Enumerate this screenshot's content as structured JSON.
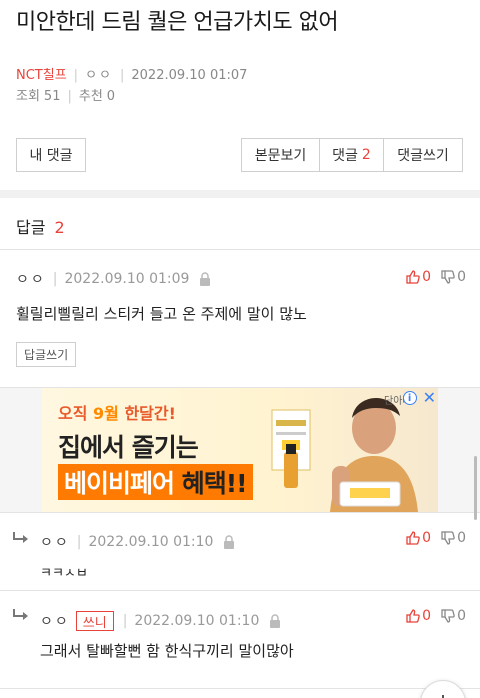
{
  "post": {
    "title": "미안한데 드림 퀄은 언급가치도 없어",
    "board": "NCT칠프",
    "author": "ㅇㅇ",
    "datetime": "2022.09.10 01:07",
    "views_label": "조회",
    "views": "51",
    "recommend_label": "추천",
    "recommend": "0"
  },
  "actions": {
    "my_comments": "내 댓글",
    "view_post": "본문보기",
    "comments_label": "댓글",
    "comments_count": "2",
    "write_comment": "댓글쓰기"
  },
  "replies_header": {
    "label": "답글",
    "count": "2"
  },
  "comments": [
    {
      "author": "ㅇㅇ",
      "datetime": "2022.09.10 01:09",
      "text": "휠릴리삘릴리 스티커 들고 온 주제에 말이 많노",
      "up": "0",
      "down": "0",
      "reply_button": "답글쓰기"
    },
    {
      "author": "ㅇㅇ",
      "datetime": "2022.09.10 01:10",
      "text": "ㅋㅋㅅㅂ",
      "up": "0",
      "down": "0"
    },
    {
      "author": "ㅇㅇ",
      "badge": "쓰니",
      "datetime": "2022.09.10 01:10",
      "text": "그래서 탈빠할뻔 함 한식구끼리 말이많아",
      "up": "0",
      "down": "0"
    }
  ],
  "ad": {
    "line1_a": "오직 ",
    "line1_hi": "9월",
    "line1_b": " 한달간!",
    "line2": "집에서 즐기는",
    "line3": "베이비페어",
    "line3_b": " 혜택!!",
    "logo": "단아빠",
    "info_icon": "i",
    "close_icon": "✕"
  },
  "colors": {
    "accent": "#e8433a",
    "ad_orange": "#ff7a00"
  }
}
